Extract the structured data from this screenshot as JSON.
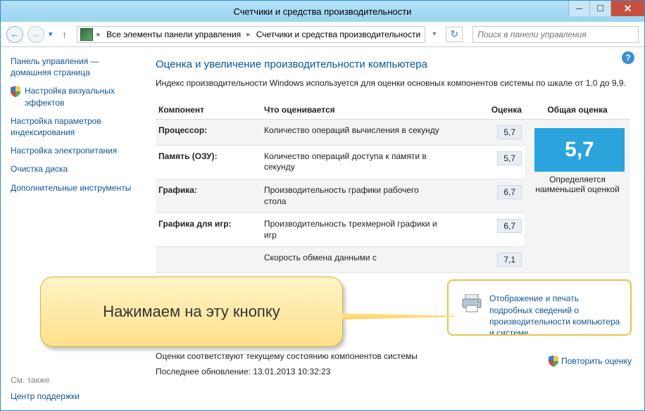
{
  "window": {
    "title": "Счетчики и средства производительности"
  },
  "nav": {
    "breadcrumb": [
      "Все элементы панели управления",
      "Счетчики и средства производительности"
    ],
    "search_placeholder": "Поиск в панели управления"
  },
  "sidebar": {
    "items": [
      {
        "label": "Панель управления — домашняя страница",
        "shield": false
      },
      {
        "label": "Настройка визуальных эффектов",
        "shield": true
      },
      {
        "label": "Настройка параметров индексирования",
        "shield": false
      },
      {
        "label": "Настройка электропитания",
        "shield": false
      },
      {
        "label": "Очистка диска",
        "shield": false
      },
      {
        "label": "Дополнительные инструменты",
        "shield": false
      }
    ],
    "see_also_header": "См. также",
    "see_also_link": "Центр поддержки"
  },
  "main": {
    "heading": "Оценка и увеличение производительности компьютера",
    "subtitle": "Индекс производительности Windows используется для оценки основных компонентов системы по шкале от 1,0 до 9,9.",
    "columns": {
      "component": "Компонент",
      "what": "Что оценивается",
      "score": "Оценка",
      "base": "Общая оценка"
    },
    "rows": [
      {
        "component": "Процессор:",
        "what": "Количество операций вычисления в секунду",
        "score": "5,7"
      },
      {
        "component": "Память (ОЗУ):",
        "what": "Количество операций доступа к памяти в секунду",
        "score": "5,7"
      },
      {
        "component": "Графика:",
        "what": "Производительность графики рабочего стола",
        "score": "6,7"
      },
      {
        "component": "Графика для игр:",
        "what": "Производительность трехмерной графики и игр",
        "score": "6,7"
      },
      {
        "component": "",
        "what": "Скорость обмена данными с",
        "score": "7,1"
      }
    ],
    "base_score": "5,7",
    "base_caption": "Определяется наименьшей оценкой",
    "print_link": "Отображение и печать подробных сведений о производительности компьютера и системе",
    "status1": "Оценки соответствуют текущему состоянию компонентов системы",
    "status2": "Последнее обновление: 13.01.2013 10:32:23",
    "rescore": "Повторить оценку"
  },
  "callout": {
    "text": "Нажимаем на эту кнопку"
  }
}
